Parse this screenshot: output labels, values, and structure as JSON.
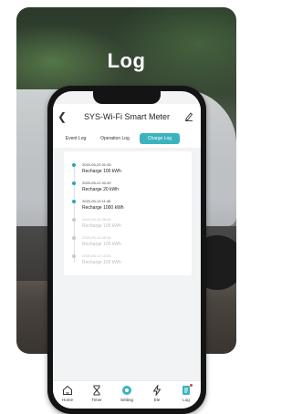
{
  "card": {
    "title": "Log"
  },
  "app": {
    "title": "SYS-Wi-Fi Smart Meter",
    "tabs": [
      {
        "label": "Event Log",
        "active": false
      },
      {
        "label": "Operation Log",
        "active": false
      },
      {
        "label": "Charge Log",
        "active": true
      }
    ],
    "entries": [
      {
        "date": "2020-05-23 01:45",
        "text": "Recharge 100 kWh",
        "active": true
      },
      {
        "date": "2020-05-21 02:49",
        "text": "Recharge 20 kWh",
        "active": true
      },
      {
        "date": "2020-05-13 11:45",
        "text": "Recharge 1000 kWh",
        "active": true
      },
      {
        "date": "2020-05-13 05:44",
        "text": "Recharge 100 kWh",
        "active": false
      },
      {
        "date": "2020-05-13 05:44",
        "text": "Recharge 100 kWh",
        "active": false
      },
      {
        "date": "2020-05-13 10:54",
        "text": "Recharge 100 kWh",
        "active": false
      }
    ],
    "nav": [
      {
        "label": "Home",
        "icon": "home-icon"
      },
      {
        "label": "Timer",
        "icon": "hourglass-icon"
      },
      {
        "label": "Setting",
        "icon": "setting-icon"
      },
      {
        "label": "Ele",
        "icon": "lightning-icon"
      },
      {
        "label": "Log",
        "icon": "log-icon"
      }
    ],
    "colors": {
      "accent": "#3bb3bf",
      "badge": "#e53935"
    }
  }
}
